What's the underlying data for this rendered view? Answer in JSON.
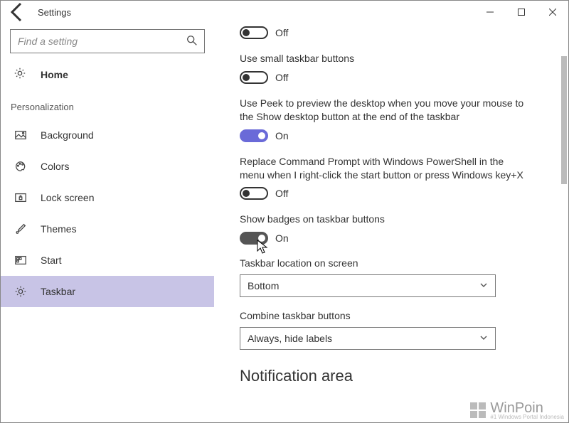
{
  "window": {
    "title": "Settings",
    "search_placeholder": "Find a setting"
  },
  "sidebar": {
    "home_label": "Home",
    "section": "Personalization",
    "items": [
      {
        "id": "background",
        "label": "Background"
      },
      {
        "id": "colors",
        "label": "Colors"
      },
      {
        "id": "lockscreen",
        "label": "Lock screen"
      },
      {
        "id": "themes",
        "label": "Themes"
      },
      {
        "id": "start",
        "label": "Start"
      },
      {
        "id": "taskbar",
        "label": "Taskbar"
      }
    ],
    "selected": "taskbar"
  },
  "settings": {
    "first_toggle": {
      "state": "off",
      "state_label": "Off"
    },
    "small_buttons": {
      "text": "Use small taskbar buttons",
      "state": "off",
      "state_label": "Off"
    },
    "peek": {
      "text": "Use Peek to preview the desktop when you move your mouse to the Show desktop button at the end of the taskbar",
      "state": "on",
      "state_label": "On"
    },
    "powershell": {
      "text": "Replace Command Prompt with Windows PowerShell in the menu when I right-click the start button or press Windows key+X",
      "state": "off",
      "state_label": "Off"
    },
    "badges": {
      "text": "Show badges on taskbar buttons",
      "state": "on",
      "state_label": "On"
    },
    "location": {
      "label": "Taskbar location on screen",
      "value": "Bottom"
    },
    "combine": {
      "label": "Combine taskbar buttons",
      "value": "Always, hide labels"
    },
    "next_section": "Notification area"
  },
  "watermark": {
    "brand": "WinPoin",
    "tagline": "#1 Windows Portal Indonesia"
  }
}
